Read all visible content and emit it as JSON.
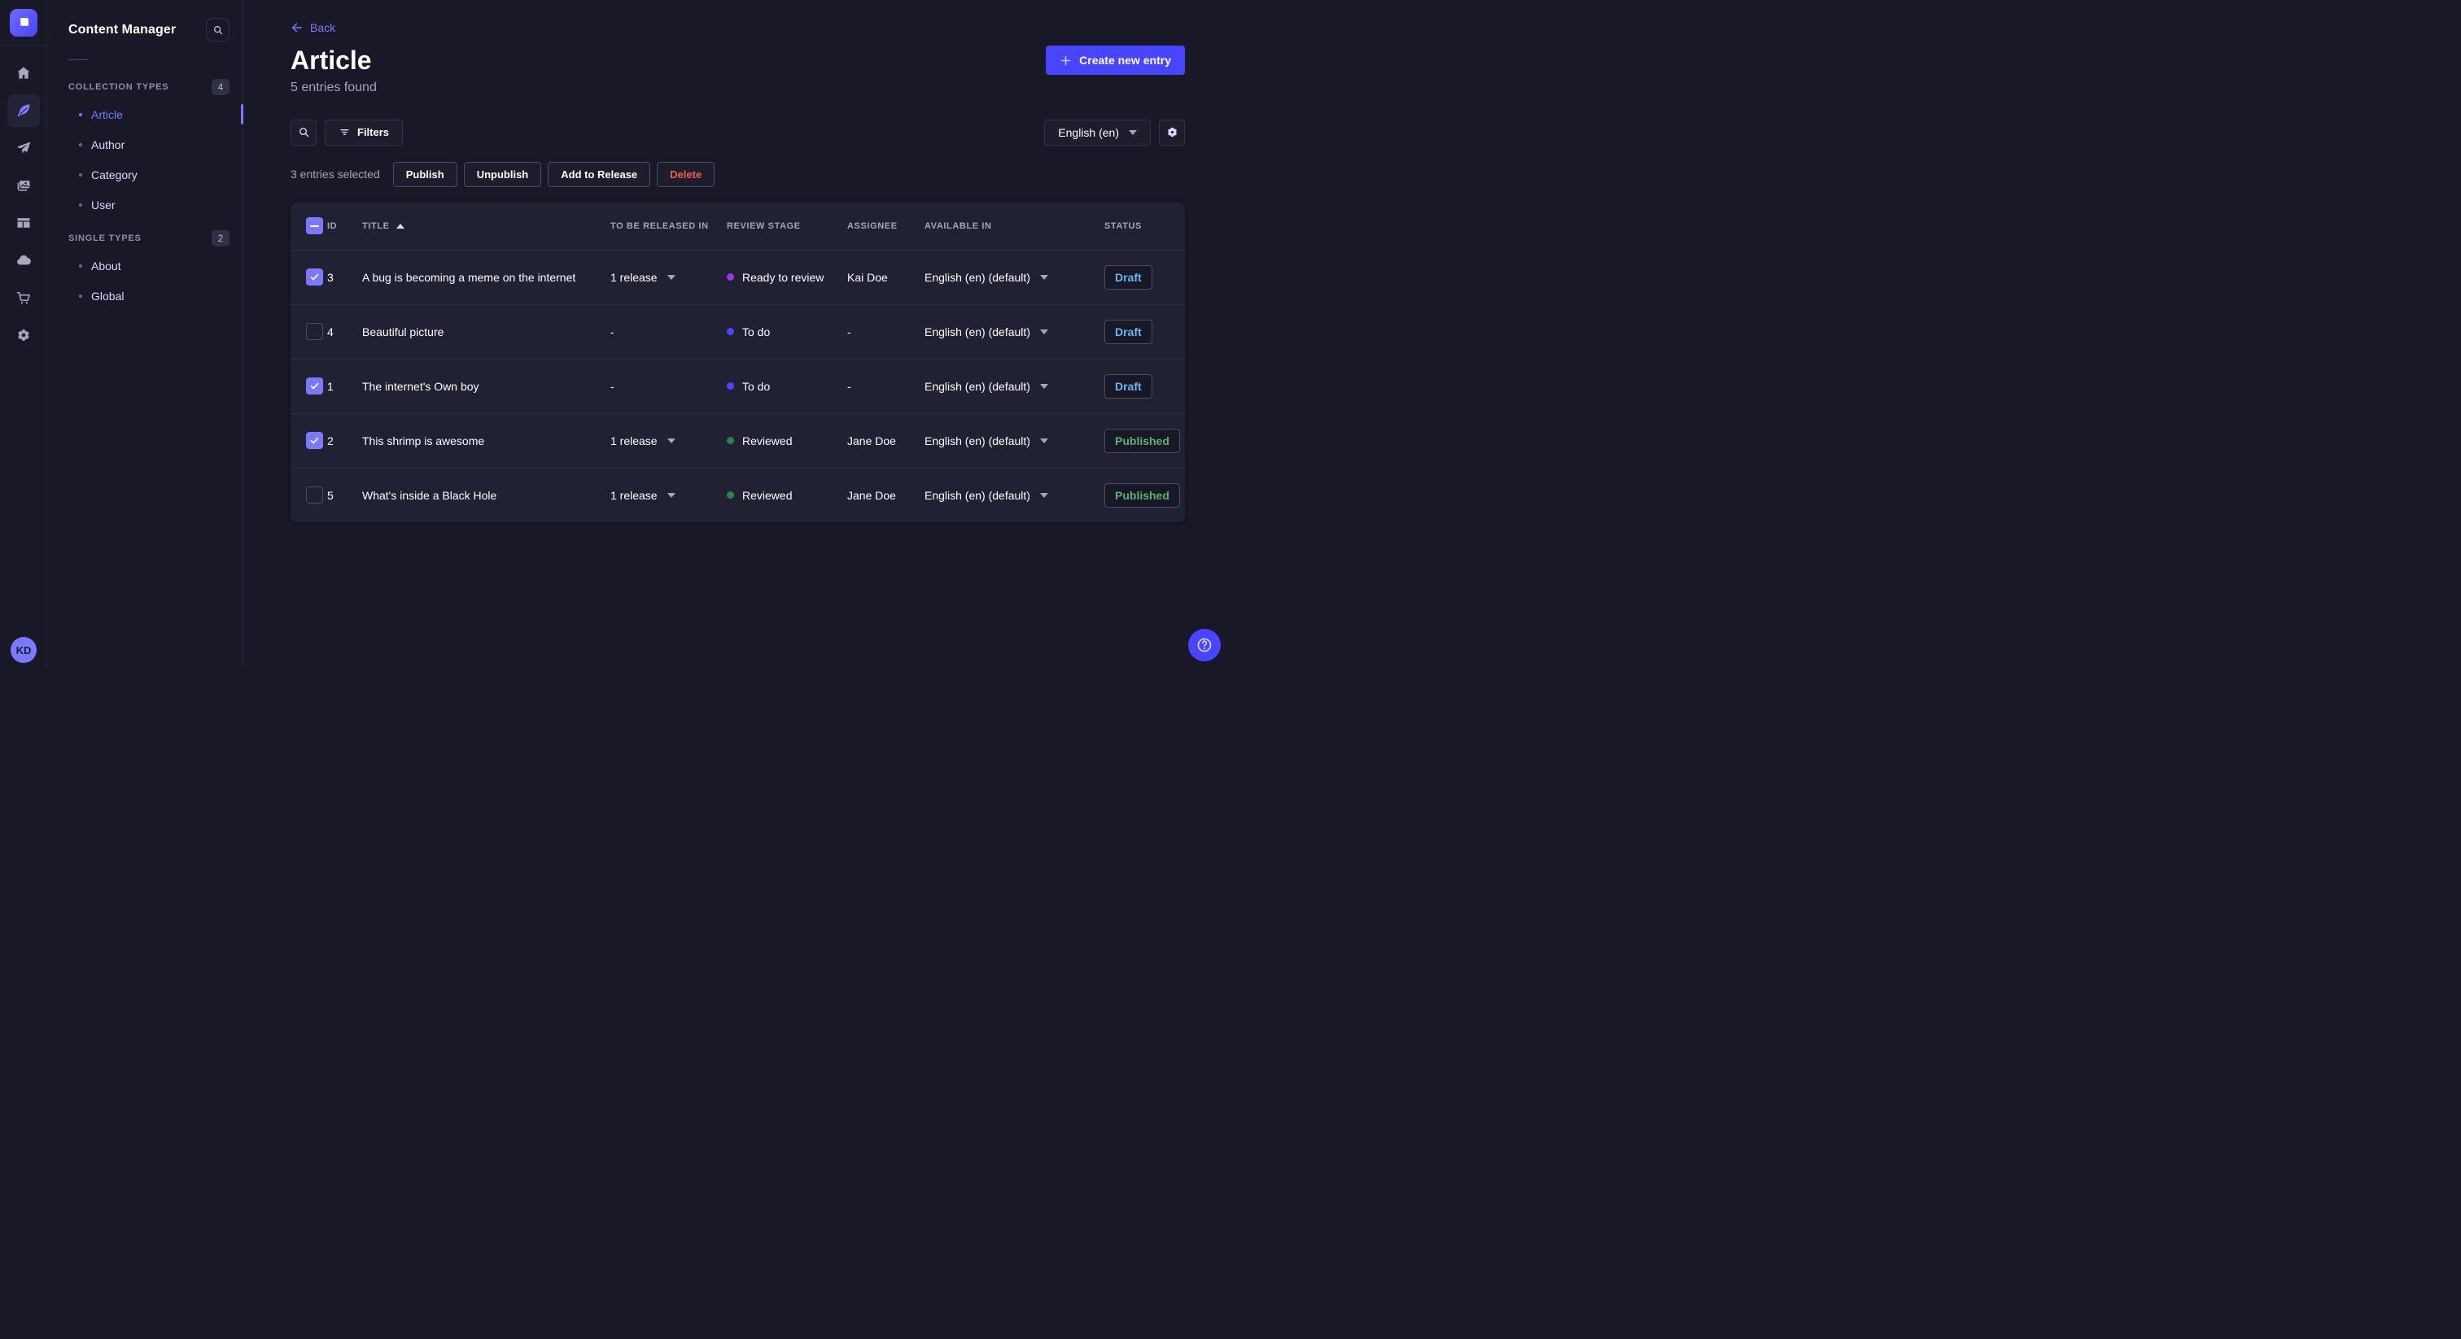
{
  "app": {
    "brand_color": "#4945ff",
    "accent_color": "#7b79ff",
    "page_bg": "#181826",
    "panel_bg": "#212134"
  },
  "rail": {
    "logo_icon": "strapi-logo",
    "items": [
      {
        "icon": "home",
        "active": false
      },
      {
        "icon": "content-feather",
        "active": true
      },
      {
        "icon": "release-plane",
        "active": false
      },
      {
        "icon": "media-library",
        "active": false
      },
      {
        "icon": "content-type-builder",
        "active": false
      },
      {
        "icon": "cloud",
        "active": false
      },
      {
        "icon": "marketplace-cart",
        "active": false
      },
      {
        "icon": "settings-gear",
        "active": false
      }
    ],
    "user_initials": "KD"
  },
  "sidebar": {
    "title": "Content Manager",
    "search_icon": "search",
    "sections": [
      {
        "label": "COLLECTION TYPES",
        "count": "4",
        "items": [
          {
            "label": "Article",
            "active": true
          },
          {
            "label": "Author",
            "active": false
          },
          {
            "label": "Category",
            "active": false
          },
          {
            "label": "User",
            "active": false
          }
        ]
      },
      {
        "label": "SINGLE TYPES",
        "count": "2",
        "items": [
          {
            "label": "About",
            "active": false
          },
          {
            "label": "Global",
            "active": false
          }
        ]
      }
    ]
  },
  "header": {
    "back_label": "Back",
    "title": "Article",
    "subtitle": "5 entries found",
    "create_label": "Create new entry"
  },
  "toolbar": {
    "filters_label": "Filters",
    "locale_value": "English (en)"
  },
  "selection": {
    "summary": "3 entries selected",
    "publish": "Publish",
    "unpublish": "Unpublish",
    "add_to_release": "Add to Release",
    "delete": "Delete"
  },
  "table": {
    "headers": {
      "id": "ID",
      "title": "TITLE",
      "released": "TO BE RELEASED IN",
      "review": "REVIEW STAGE",
      "assignee": "ASSIGNEE",
      "available": "AVAILABLE IN",
      "status": "STATUS"
    },
    "sort_column": "TITLE",
    "sort_direction": "ascending",
    "header_checkbox_state": "indeterminate",
    "rows": [
      {
        "checked": true,
        "id": "3",
        "title": "A bug is becoming a meme on the internet",
        "to_be_released_in": "1 release",
        "review_stage": "Ready to review",
        "review_stage_color": "#9736e8",
        "assignee": "Kai Doe",
        "available_in": "English (en) (default)",
        "status": "Draft",
        "status_color": "#66b7f1"
      },
      {
        "checked": false,
        "id": "4",
        "title": "Beautiful picture",
        "to_be_released_in": "-",
        "review_stage": "To do",
        "review_stage_color": "#4945ff",
        "assignee": "-",
        "available_in": "English (en) (default)",
        "status": "Draft",
        "status_color": "#66b7f1"
      },
      {
        "checked": true,
        "id": "1",
        "title": "The internet's Own boy",
        "to_be_released_in": "-",
        "review_stage": "To do",
        "review_stage_color": "#4945ff",
        "assignee": "-",
        "available_in": "English (en) (default)",
        "status": "Draft",
        "status_color": "#66b7f1"
      },
      {
        "checked": true,
        "id": "2",
        "title": "This shrimp is awesome",
        "to_be_released_in": "1 release",
        "review_stage": "Reviewed",
        "review_stage_color": "#328048",
        "assignee": "Jane Doe",
        "available_in": "English (en) (default)",
        "status": "Published",
        "status_color": "#5cb176"
      },
      {
        "checked": false,
        "id": "5",
        "title": "What's inside a Black Hole",
        "to_be_released_in": "1 release",
        "review_stage": "Reviewed",
        "review_stage_color": "#328048",
        "assignee": "Jane Doe",
        "available_in": "English (en) (default)",
        "status": "Published",
        "status_color": "#5cb176"
      }
    ]
  },
  "help": {
    "icon": "question-circle"
  }
}
